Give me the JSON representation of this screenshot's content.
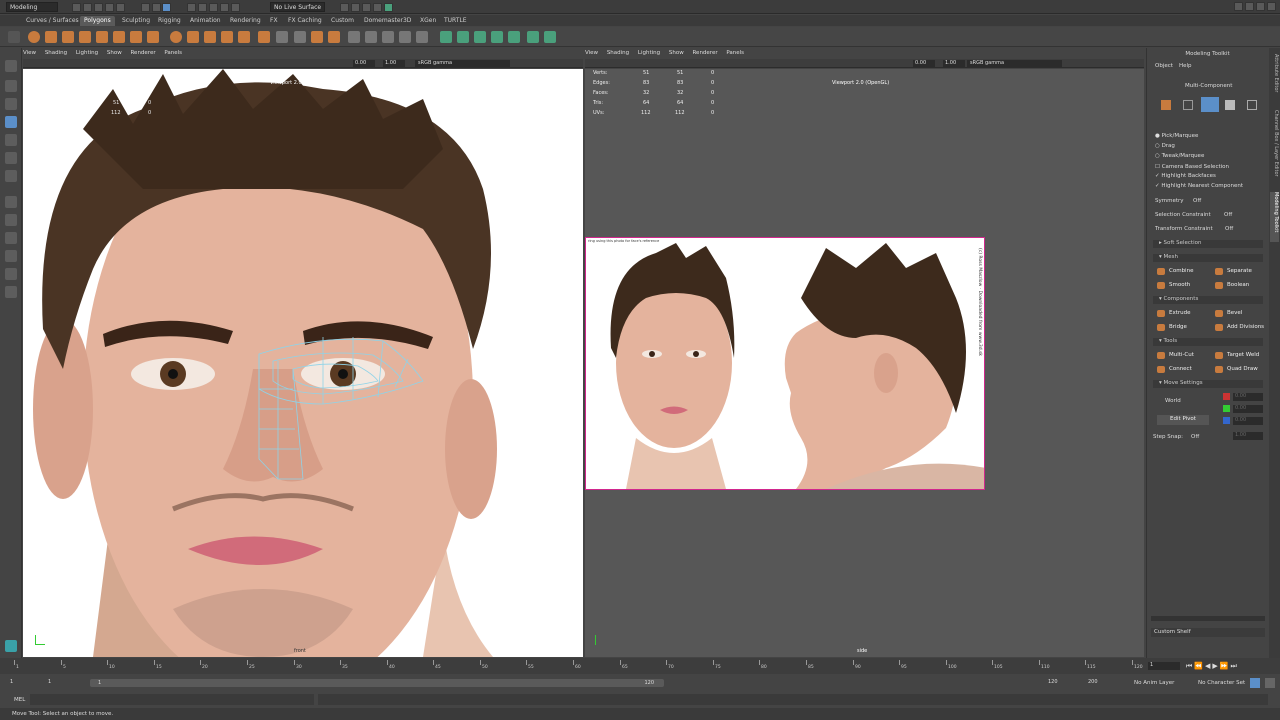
{
  "statusline": {
    "mode": "Modeling",
    "live_surface": "No Live Surface"
  },
  "shelf_tabs": [
    "Curves / Surfaces",
    "Polygons",
    "Sculpting",
    "Rigging",
    "Animation",
    "Rendering",
    "FX",
    "FX Caching",
    "Custom",
    "Domemaster3D",
    "XGen",
    "TURTLE"
  ],
  "panels": {
    "menu": [
      "View",
      "Shading",
      "Lighting",
      "Show",
      "Renderer",
      "Panels"
    ],
    "value_a": "0.00",
    "value_b": "1.00",
    "gamma": "sRGB gamma",
    "left_label": "Viewport 2.0 (OpenGL)",
    "right_label": "Viewport 2.0 (OpenGL)",
    "front_name": "front",
    "side_name": "side"
  },
  "hud_left": {
    "v1": "51",
    "v2": "112",
    "z1": "0",
    "z2": "0"
  },
  "hud_right": {
    "rows": [
      {
        "label": "Verts:",
        "a": "51",
        "b": "51",
        "c": "0"
      },
      {
        "label": "Edges:",
        "a": "83",
        "b": "83",
        "c": "0"
      },
      {
        "label": "Faces:",
        "a": "32",
        "b": "32",
        "c": "0"
      },
      {
        "label": "Tris:",
        "a": "64",
        "b": "64",
        "c": "0"
      },
      {
        "label": "UVs:",
        "a": "112",
        "b": "112",
        "c": "0"
      }
    ]
  },
  "reference": {
    "top_note": "ring using this photo for face's reference",
    "vertical_text": "(c) Ross Maszlow · Downloaded from www.3d.sk"
  },
  "toolkit": {
    "title": "Modeling Toolkit",
    "menu_object": "Object",
    "menu_help": "Help",
    "mode": "Multi-Component",
    "pick": "Pick/Marquee",
    "drag": "Drag",
    "tweak": "Tweak/Marquee",
    "camera_sel": "Camera Based Selection",
    "highlight_back": "Highlight Backfaces",
    "highlight_near": "Highlight Nearest Component",
    "symmetry_label": "Symmetry",
    "symmetry_value": "Off",
    "sel_constraint_label": "Selection Constraint",
    "sel_constraint_value": "Off",
    "xform_constraint_label": "Transform Constraint",
    "xform_constraint_value": "Off",
    "soft_selection": "Soft Selection",
    "mesh": "Mesh",
    "combine": "Combine",
    "separate": "Separate",
    "smooth": "Smooth",
    "boolean": "Boolean",
    "components": "Components",
    "extrude": "Extrude",
    "bevel": "Bevel",
    "bridge": "Bridge",
    "add_divisions": "Add Divisions",
    "tools": "Tools",
    "multi_cut": "Multi-Cut",
    "target_weld": "Target Weld",
    "connect": "Connect",
    "quad_draw": "Quad Draw",
    "move_settings": "Move Settings",
    "world": "World",
    "edit_pivot": "Edit Pivot",
    "axis_val": "0.00",
    "step_snap_label": "Step Snap:",
    "step_snap_value": "Off",
    "step_val": "1.00",
    "custom_shelf": "Custom Shelf"
  },
  "side_tabs": [
    "Attribute Editor",
    "Channel Box / Layer Editor",
    "Modeling Toolkit"
  ],
  "time": {
    "ticks": [
      "1",
      "5",
      "10",
      "15",
      "20",
      "25",
      "30",
      "35",
      "40",
      "45",
      "50",
      "55",
      "60",
      "65",
      "70",
      "75",
      "80",
      "85",
      "90",
      "95",
      "100",
      "105",
      "110",
      "115",
      "120"
    ],
    "current": "1",
    "start": "1",
    "start2": "1",
    "range_end": "120",
    "end": "120",
    "end2": "200",
    "anim_layer": "No Anim Layer",
    "char_set": "No Character Set"
  },
  "cmdline": {
    "lang": "MEL"
  },
  "helpline": {
    "text": "Move Tool: Select an object to move."
  },
  "colors": {
    "accent": "#5b8fc9",
    "orange": "#c87b3e",
    "mesh": "#8fd3e8",
    "magenta": "#d1278d"
  }
}
